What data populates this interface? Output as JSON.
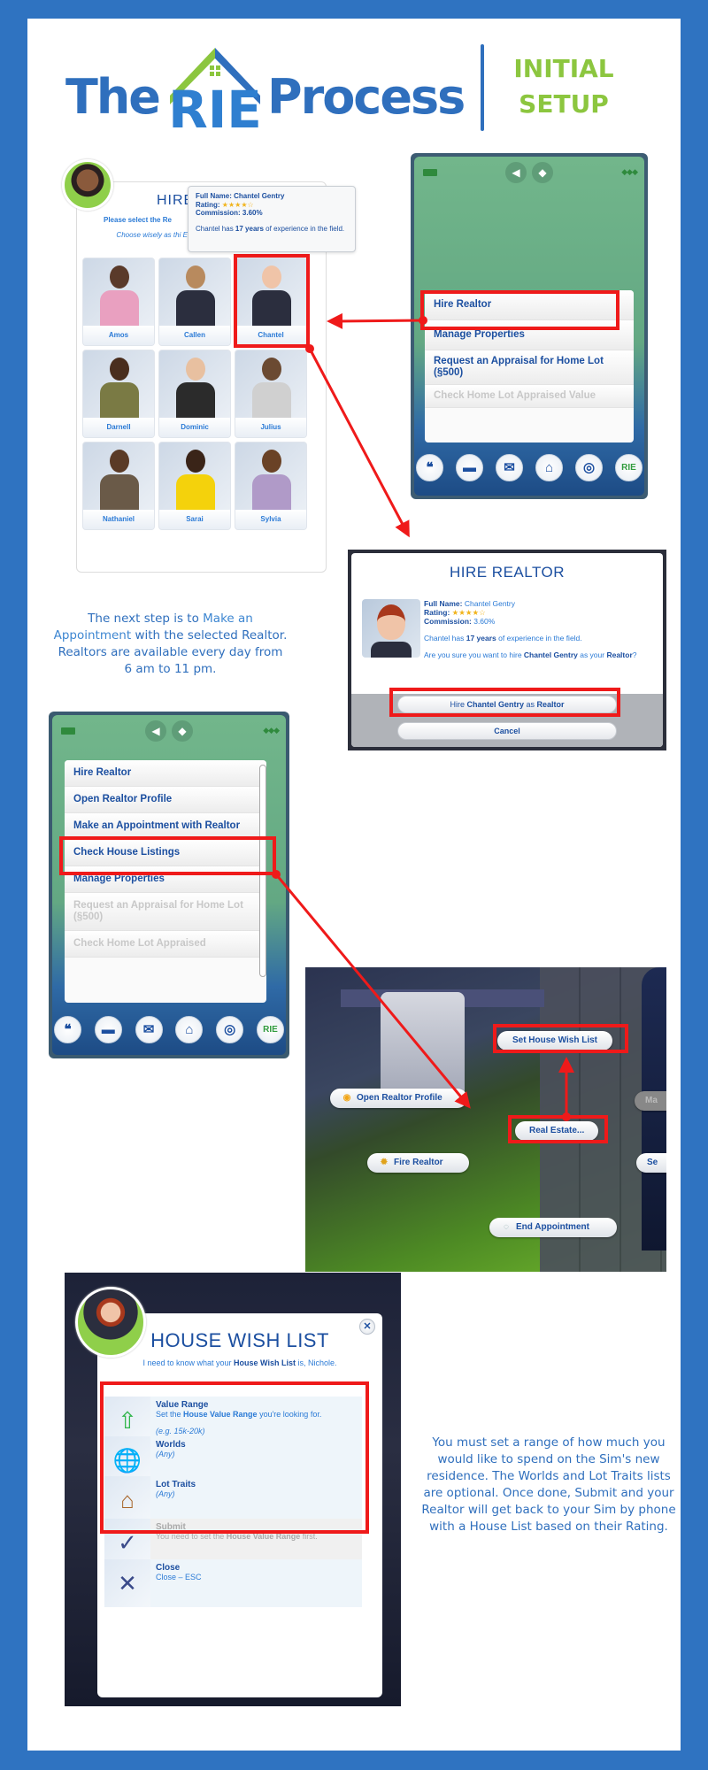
{
  "header": {
    "logo_the": "The",
    "logo_rie": "RIE",
    "logo_process": "Process",
    "tag_line1": "INITIAL",
    "tag_line2": "SETUP",
    "colors": {
      "brand_blue": "#2f6fbd",
      "brand_green": "#8cc63f",
      "frame": "#2f73c1",
      "highlight_red": "#ef1a1a"
    }
  },
  "hire_select": {
    "title": "HIRE",
    "subtitle": "Please select the Re",
    "hint": "Choose wisely as thi Esta",
    "tooltip": {
      "full_name_label": "Full Name:",
      "full_name": "Chantel Gentry",
      "rating_label": "Rating:",
      "rating_stars": 4,
      "rating_max": 5,
      "commission_label": "Commission:",
      "commission": "3.60%",
      "experience_pre": "Chantel has ",
      "experience_bold": "17 years",
      "experience_post": " of experience in the field."
    },
    "realtors": [
      {
        "name": "Amos"
      },
      {
        "name": "Callen"
      },
      {
        "name": "Chantel",
        "selected": true
      },
      {
        "name": "Darnell"
      },
      {
        "name": "Dominic"
      },
      {
        "name": "Julius"
      },
      {
        "name": "Nathaniel"
      },
      {
        "name": "Sarai"
      },
      {
        "name": "Sylvia"
      }
    ]
  },
  "phone1": {
    "menu": [
      {
        "label": "Hire Realtor",
        "highlighted": true
      },
      {
        "label": "Manage Properties"
      },
      {
        "label": "Request an Appraisal for Home Lot (§500)"
      },
      {
        "label": "Check Home Lot Appraised Value",
        "disabled": true
      }
    ],
    "dock": [
      "chat-icon",
      "car-icon",
      "briefcase-icon",
      "house-icon",
      "speaker-icon",
      "rie-icon"
    ],
    "dock_labels": {
      "rie": "RIE"
    }
  },
  "hire_confirm": {
    "title": "HIRE REALTOR",
    "full_name_label": "Full Name:",
    "full_name": "Chantel Gentry",
    "rating_label": "Rating:",
    "rating_stars": 4,
    "commission_label": "Commission:",
    "commission": "3.60%",
    "experience_pre": "Chantel has ",
    "experience_bold": "17 years",
    "experience_post": " of experience in the field.",
    "question_pre": "Are you sure you want to hire ",
    "question_bold": "Chantel Gentry",
    "question_post": " as your ",
    "question_bold2": "Realtor",
    "question_end": "?",
    "confirm_pre": "Hire ",
    "confirm_bold": "Chantel Gentry",
    "confirm_mid": " as ",
    "confirm_bold2": "Realtor",
    "cancel": "Cancel"
  },
  "blurb1": {
    "part1": "The next step is to ",
    "highlight": "Make an Appointment",
    "part2": " with the selected Realtor. Realtors are available every day from 6 am to 11 pm."
  },
  "phone2": {
    "menu": [
      {
        "label": "Hire Realtor"
      },
      {
        "label": "Open Realtor Profile"
      },
      {
        "label": "Make an Appointment with Realtor",
        "highlighted": true
      },
      {
        "label": "Check House Listings"
      },
      {
        "label": "Manage Properties"
      },
      {
        "label": "Request an Appraisal for Home Lot (§500)",
        "disabled": true
      },
      {
        "label": "Check Home Lot Appraised",
        "disabled": true
      }
    ]
  },
  "appointment": {
    "set_wish_list": "Set House Wish List",
    "open_profile": "Open Realtor Profile",
    "real_estate": "Real Estate...",
    "fire_realtor": "Fire Realtor",
    "end_appointment": "End Appointment",
    "partial_right_1": "Ma",
    "partial_right_2": "Se"
  },
  "wish_list": {
    "title": "HOUSE WISH LIST",
    "subtitle_pre": "I need to know what your ",
    "subtitle_bold": "House Wish List",
    "subtitle_post": " is, Nichole.",
    "rows": [
      {
        "title": "Value Range",
        "desc_pre": "Set the ",
        "desc_bold": "House Value Range",
        "desc_post": " you're looking for.",
        "hint": "(e.g. 15k-20k)",
        "icon": "value-range-icon"
      },
      {
        "title": "Worlds",
        "hint": "(Any)",
        "icon": "globe-icon"
      },
      {
        "title": "Lot Traits",
        "hint": "(Any)",
        "icon": "house-icon"
      },
      {
        "title": "Submit",
        "desc_pre": "You need to set the ",
        "desc_bold": "House Value Range",
        "desc_post": " first.",
        "disabled": true,
        "icon": "check-icon"
      },
      {
        "title": "Close",
        "desc_pre": "Close – ESC",
        "icon": "close-icon"
      }
    ]
  },
  "blurb2": {
    "text": "You must set a range of how much you would like to spend on the Sim's new residence. The Worlds and Lot Traits lists are optional. Once done, Submit and your Realtor will get back to your Sim by phone with a House List based on their Rating."
  }
}
